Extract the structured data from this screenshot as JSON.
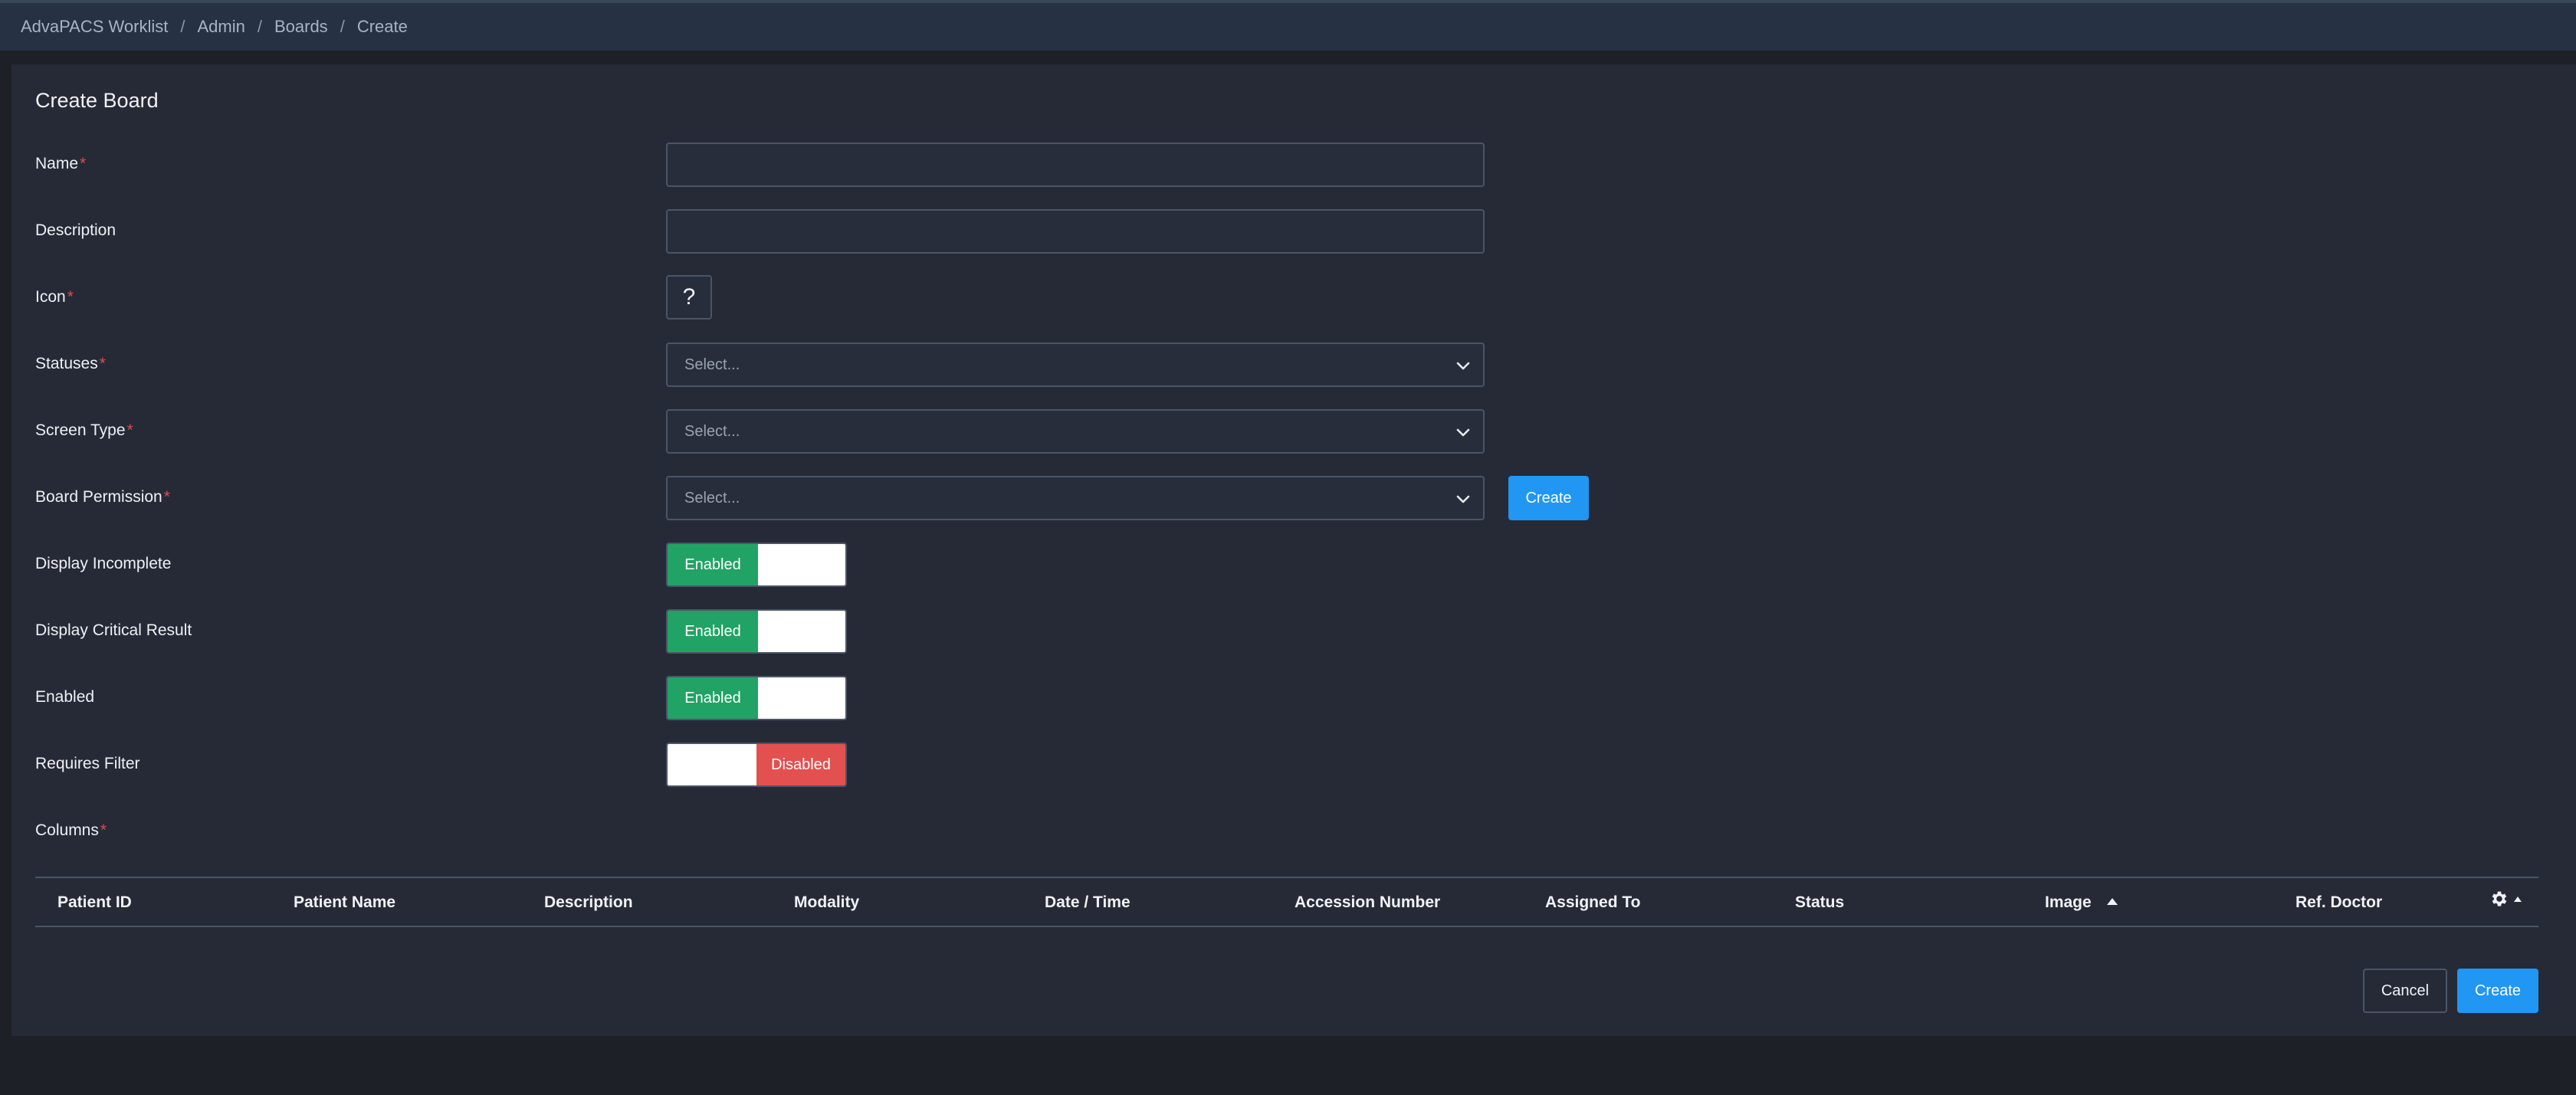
{
  "breadcrumb": [
    "AdvaPACS Worklist",
    "Admin",
    "Boards",
    "Create"
  ],
  "form": {
    "title": "Create Board",
    "required_mark": "*",
    "name_label": "Name",
    "description_label": "Description",
    "icon_label": "Icon",
    "icon_value": "?",
    "statuses_label": "Statuses",
    "statuses_placeholder": "Select...",
    "screen_type_label": "Screen Type",
    "screen_type_placeholder": "Select...",
    "board_permission_label": "Board Permission",
    "board_permission_placeholder": "Select...",
    "create_permission_label": "Create",
    "display_incomplete_label": "Display Incomplete",
    "display_incomplete_state": "Enabled",
    "display_critical_label": "Display Critical Result",
    "display_critical_state": "Enabled",
    "enabled_label": "Enabled",
    "enabled_state": "Enabled",
    "requires_filter_label": "Requires Filter",
    "requires_filter_state": "Disabled",
    "columns_label": "Columns"
  },
  "columns": [
    "Patient ID",
    "Patient Name",
    "Description",
    "Modality",
    "Date / Time",
    "Accession Number",
    "Assigned To",
    "Status",
    "Image",
    "Ref. Doctor"
  ],
  "sorted_column": "Image",
  "footer": {
    "cancel_label": "Cancel",
    "create_label": "Create"
  },
  "colors": {
    "primary": "#2196f3",
    "enabled": "#21a366",
    "disabled": "#e25050",
    "required": "#e14b4b"
  }
}
